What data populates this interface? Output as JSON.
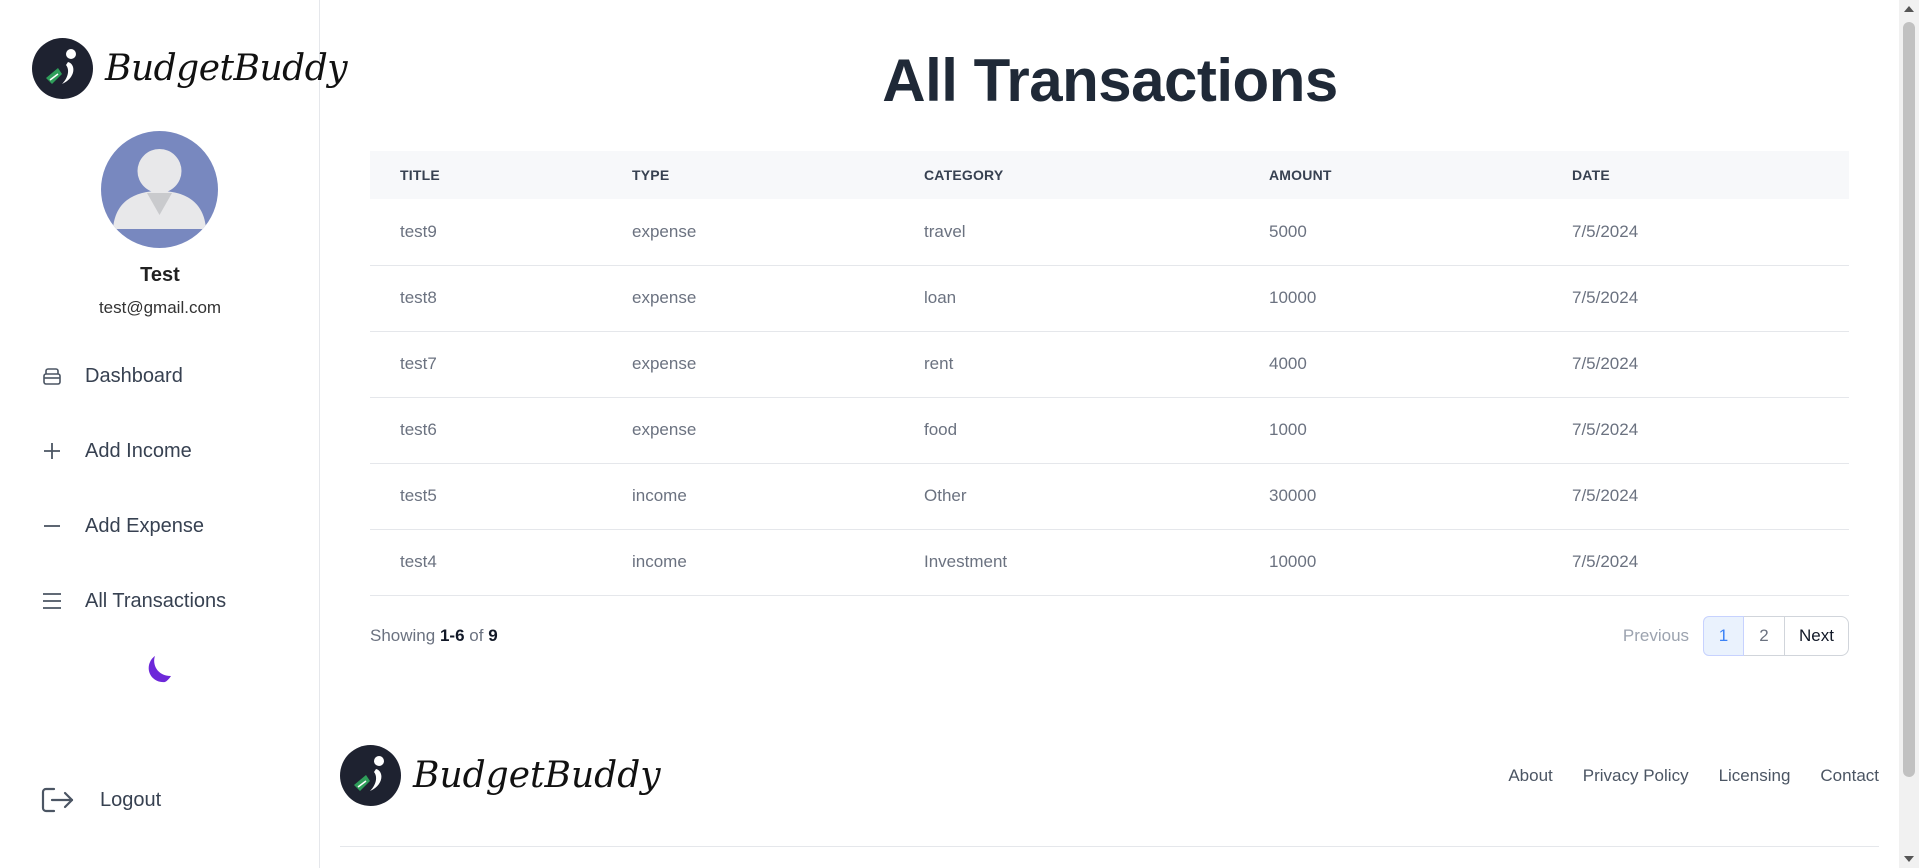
{
  "sidebar": {
    "brand": "BudgetBuddy",
    "user": {
      "name": "Test",
      "email": "test@gmail.com"
    },
    "nav": [
      {
        "label": "Dashboard",
        "icon": "dashboard-icon"
      },
      {
        "label": "Add Income",
        "icon": "plus-icon"
      },
      {
        "label": "Add Expense",
        "icon": "minus-icon"
      },
      {
        "label": "All Transactions",
        "icon": "list-icon"
      }
    ],
    "theme_icon": "moon-icon",
    "logout_label": "Logout"
  },
  "main": {
    "title": "All Transactions",
    "table": {
      "headers": [
        "TITLE",
        "TYPE",
        "CATEGORY",
        "AMOUNT",
        "DATE"
      ],
      "rows": [
        [
          "test9",
          "expense",
          "travel",
          "5000",
          "7/5/2024"
        ],
        [
          "test8",
          "expense",
          "loan",
          "10000",
          "7/5/2024"
        ],
        [
          "test7",
          "expense",
          "rent",
          "4000",
          "7/5/2024"
        ],
        [
          "test6",
          "expense",
          "food",
          "1000",
          "7/5/2024"
        ],
        [
          "test5",
          "income",
          "Other",
          "30000",
          "7/5/2024"
        ],
        [
          "test4",
          "income",
          "Investment",
          "10000",
          "7/5/2024"
        ]
      ]
    },
    "pagination": {
      "showing_prefix": "Showing",
      "range": "1-6",
      "of": "of",
      "total": "9",
      "previous": "Previous",
      "pages": [
        "1",
        "2"
      ],
      "current_page": "1",
      "next": "Next"
    }
  },
  "footer": {
    "brand": "BudgetBuddy",
    "links": [
      "About",
      "Privacy Policy",
      "Licensing",
      "Contact"
    ]
  },
  "colors": {
    "accent_moon": "#6d28d9",
    "avatar_bg": "#7888bf",
    "active_page_bg": "#eaf2fd",
    "active_page_text": "#3b82f6"
  }
}
